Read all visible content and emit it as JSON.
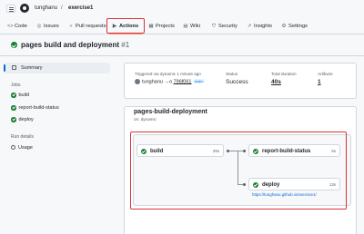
{
  "header": {
    "owner": "tunghanu",
    "separator": "/",
    "repo": "exercise1"
  },
  "tabs": [
    {
      "label": "Code",
      "icon": "code-icon",
      "glyph": "<>"
    },
    {
      "label": "Issues",
      "icon": "issue-icon",
      "glyph": "◎"
    },
    {
      "label": "Pull requests",
      "icon": "pull-request-icon",
      "glyph": "⑂"
    },
    {
      "label": "Actions",
      "icon": "play-icon",
      "glyph": "▶"
    },
    {
      "label": "Projects",
      "icon": "table-icon",
      "glyph": "▦"
    },
    {
      "label": "Wiki",
      "icon": "book-icon",
      "glyph": "▤"
    },
    {
      "label": "Security",
      "icon": "shield-icon",
      "glyph": "⛉"
    },
    {
      "label": "Insights",
      "icon": "graph-icon",
      "glyph": "↗"
    },
    {
      "label": "Settings",
      "icon": "gear-icon",
      "glyph": "⚙"
    }
  ],
  "run": {
    "title": "pages build and deployment",
    "number": "#1"
  },
  "sidebar": {
    "summary": "Summary",
    "jobs_heading": "Jobs",
    "jobs": [
      "build",
      "report-build-status",
      "deploy"
    ],
    "run_details_heading": "Run details",
    "usage": "Usage"
  },
  "summary": {
    "trigger_label": "Triggered via dynamic 1 minute ago",
    "actor": "tunghanu",
    "arrow": "→o",
    "sha": "796f061",
    "branch": "main",
    "status_label": "Status",
    "status": "Success",
    "duration_label": "Total duration",
    "duration": "40s",
    "artifacts_label": "Artifacts",
    "artifacts": "1"
  },
  "workflow": {
    "title": "pages-build-deployment",
    "subtitle": "on: dynamic",
    "jobs": {
      "build": {
        "name": "build",
        "time": "25s"
      },
      "report": {
        "name": "report-build-status",
        "time": "6s"
      },
      "deploy": {
        "name": "deploy",
        "time": "13s"
      }
    },
    "deploy_url": "https://tunghanu.github.io/exercise1/"
  },
  "colors": {
    "success": "#1a7f37",
    "highlight": "#d9343a",
    "link": "#0969da"
  }
}
